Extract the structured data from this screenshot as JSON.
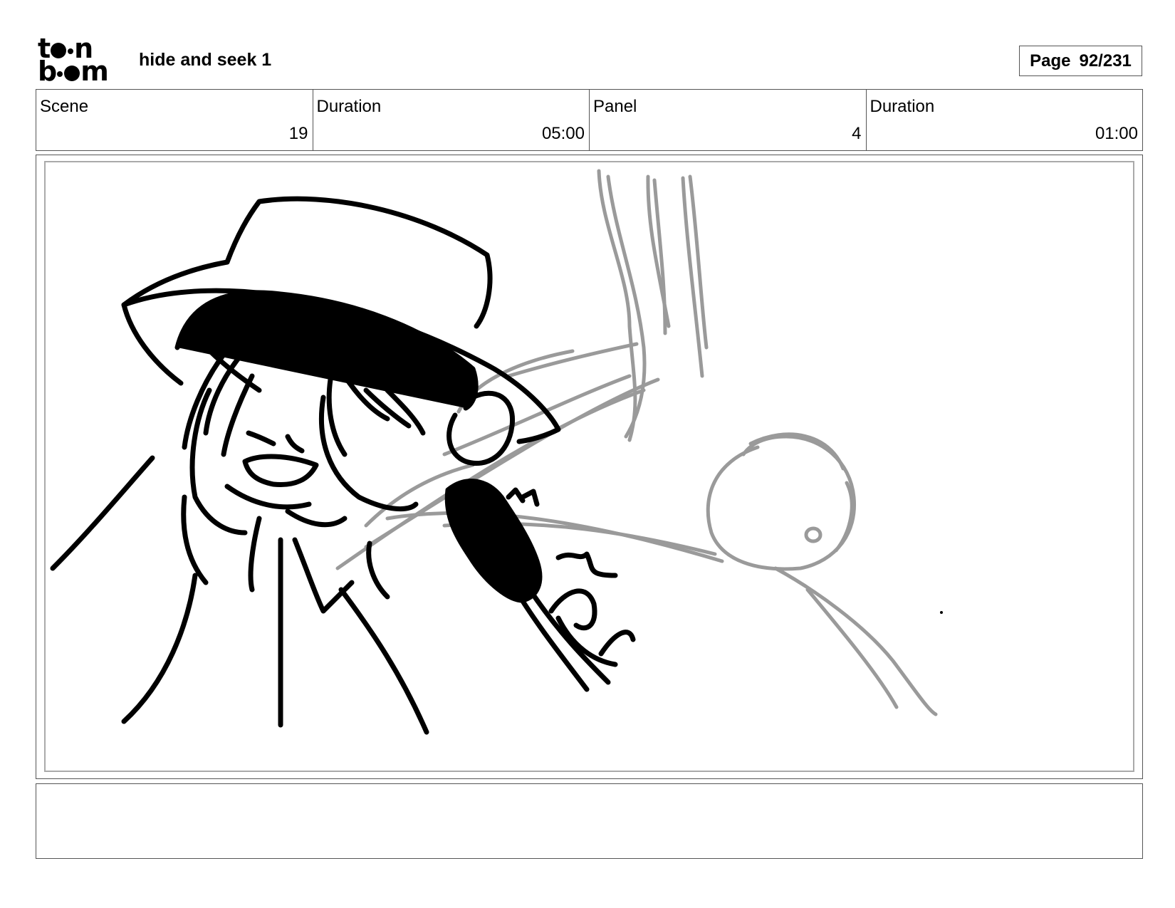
{
  "logo": {
    "name": "toon boom",
    "icon": "toon-boom-logo"
  },
  "header": {
    "title": "hide and seek 1"
  },
  "page": {
    "label": "Page",
    "value": "92/231"
  },
  "info": {
    "scene_label": "Scene",
    "scene_value": "19",
    "scene_duration_label": "Duration",
    "scene_duration_value": "05:00",
    "panel_label": "Panel",
    "panel_value": "4",
    "panel_duration_label": "Duration",
    "panel_duration_value": "01:00"
  },
  "panel": {
    "image": "storyboard-sketch",
    "ink_color": "#000000",
    "rough_color": "#9a9a9a"
  },
  "notes": {
    "text": ""
  }
}
